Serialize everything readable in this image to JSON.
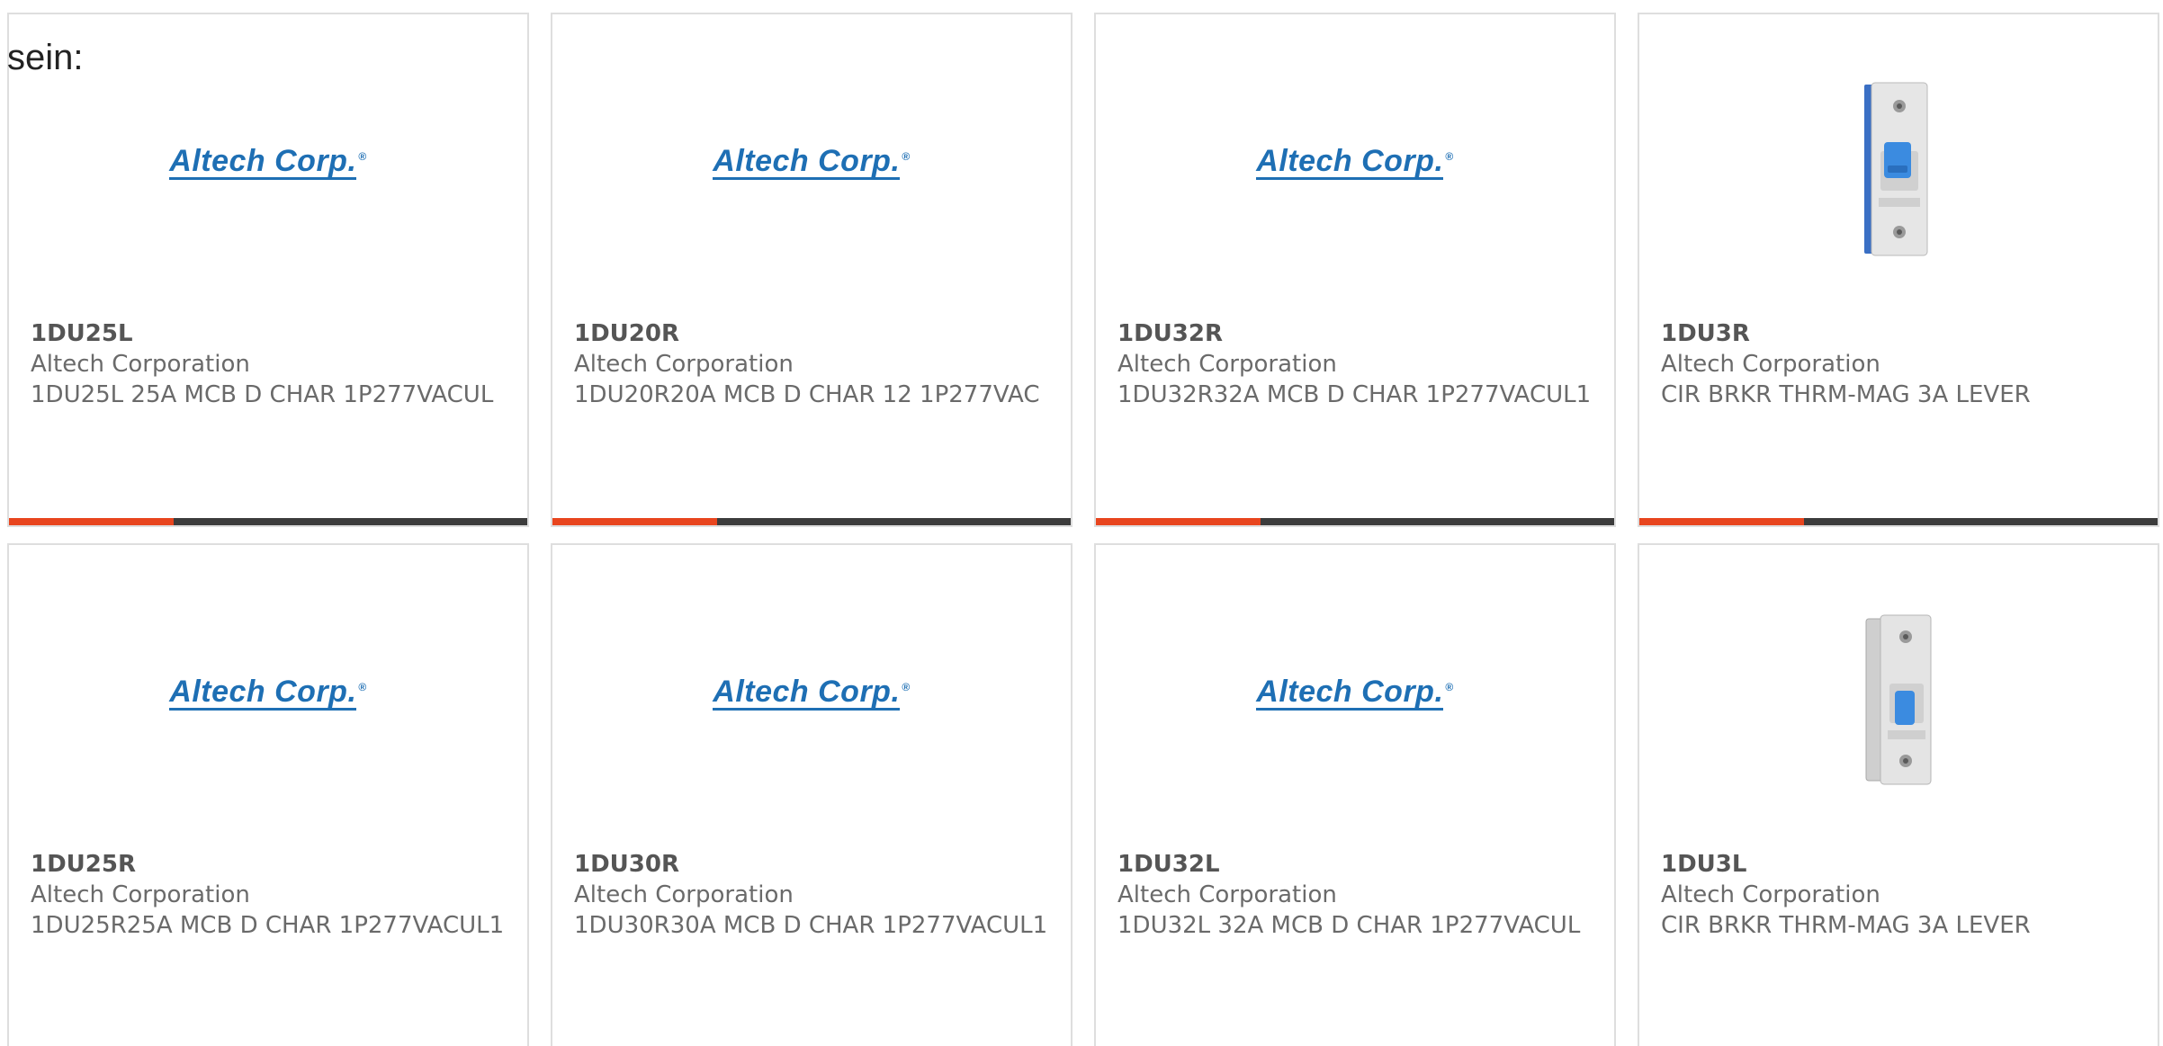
{
  "intro_text": "sein:",
  "brand_logo_text": "Altech Corp.",
  "brand_logo_mark": "®",
  "colors": {
    "accent": "#e8451e",
    "bar_dark": "#3c3c3c",
    "logo_blue": "#1e6fb4",
    "card_border": "#dedede",
    "text_gray": "#6a6a6a"
  },
  "products": [
    {
      "part_number": "1DU25L",
      "manufacturer": "Altech Corporation",
      "description": "1DU25L 25A MCB D CHAR 1P277VACUL",
      "image": "altech-logo",
      "show_bar": true
    },
    {
      "part_number": "1DU20R",
      "manufacturer": "Altech Corporation",
      "description": "1DU20R20A MCB D CHAR 12 1P277VAC",
      "image": "altech-logo",
      "show_bar": true
    },
    {
      "part_number": "1DU32R",
      "manufacturer": "Altech Corporation",
      "description": "1DU32R32A MCB D CHAR 1P277VACUL1",
      "image": "altech-logo",
      "show_bar": true
    },
    {
      "part_number": "1DU3R",
      "manufacturer": "Altech Corporation",
      "description": "CIR BRKR THRM-MAG 3A LEVER",
      "image": "circuit-breaker-photo",
      "show_bar": true
    },
    {
      "part_number": "1DU25R",
      "manufacturer": "Altech Corporation",
      "description": "1DU25R25A MCB D CHAR 1P277VACUL1",
      "image": "altech-logo",
      "show_bar": false
    },
    {
      "part_number": "1DU30R",
      "manufacturer": "Altech Corporation",
      "description": "1DU30R30A MCB D CHAR 1P277VACUL1",
      "image": "altech-logo",
      "show_bar": false
    },
    {
      "part_number": "1DU32L",
      "manufacturer": "Altech Corporation",
      "description": "1DU32L 32A MCB D CHAR 1P277VACUL",
      "image": "altech-logo",
      "show_bar": false
    },
    {
      "part_number": "1DU3L",
      "manufacturer": "Altech Corporation",
      "description": "CIR BRKR THRM-MAG 3A LEVER",
      "image": "circuit-breaker-photo",
      "show_bar": false
    }
  ]
}
